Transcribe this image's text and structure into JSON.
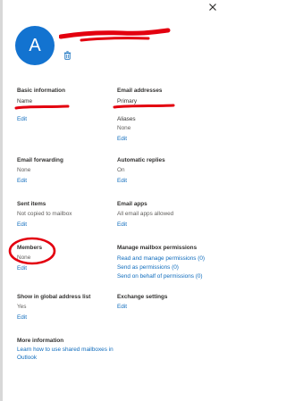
{
  "header": {
    "avatar_initial": "A",
    "icons": {
      "close": "close-icon",
      "delete": "trash-icon"
    }
  },
  "basic_information": {
    "title": "Basic information",
    "name_label": "Name",
    "edit": "Edit"
  },
  "email_addresses": {
    "title": "Email addresses",
    "primary_label": "Primary",
    "aliases_label": "Aliases",
    "aliases_value": "None",
    "edit": "Edit"
  },
  "email_forwarding": {
    "title": "Email forwarding",
    "value": "None",
    "edit": "Edit"
  },
  "automatic_replies": {
    "title": "Automatic replies",
    "value": "On",
    "edit": "Edit"
  },
  "sent_items": {
    "title": "Sent items",
    "value": "Not copied to mailbox",
    "edit": "Edit"
  },
  "email_apps": {
    "title": "Email apps",
    "value": "All email apps allowed",
    "edit": "Edit"
  },
  "members": {
    "title": "Members",
    "value": "None",
    "edit": "Edit"
  },
  "mailbox_permissions": {
    "title": "Manage mailbox permissions",
    "links": [
      "Read and manage permissions (0)",
      "Send as permissions (0)",
      "Send on behalf of permissions (0)"
    ]
  },
  "global_address_list": {
    "title": "Show in global address list",
    "value": "Yes",
    "edit": "Edit"
  },
  "exchange_settings": {
    "title": "Exchange settings",
    "edit": "Edit"
  },
  "more_information": {
    "title": "More information",
    "link": "Learn how to use shared mailboxes in Outlook"
  },
  "annotation_color": "#e3000f",
  "accent_color": "#0f6cbd"
}
